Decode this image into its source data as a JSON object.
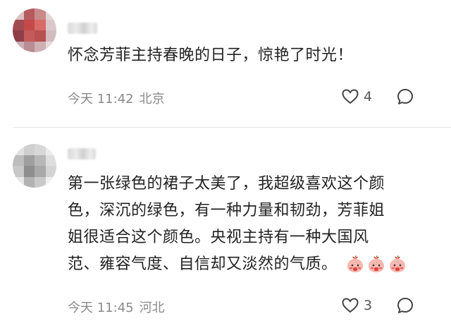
{
  "comments": [
    {
      "text": "怀念芳菲主持春晚的日子，惊艳了时光！",
      "time": "今天 11:42",
      "location": "北京",
      "likes": "4"
    },
    {
      "text_lines": [
        "第一张绿色的裙子太美了，我超级喜欢这个颜",
        "色，深沉的绿色，有一种力量和韧劲，芳菲姐",
        "姐很适合这个颜色。央视主持有一种大国风",
        "范、雍容气度、自信却又淡然的气质。"
      ],
      "emoji_count": 3,
      "time": "今天 11:45",
      "location": "河北",
      "likes": "3"
    }
  ],
  "colors": {
    "meta": "#8a8a8a",
    "divider": "#e6e6e6",
    "emoji_body": "#f6b8b0",
    "emoji_accent": "#e0453c"
  }
}
